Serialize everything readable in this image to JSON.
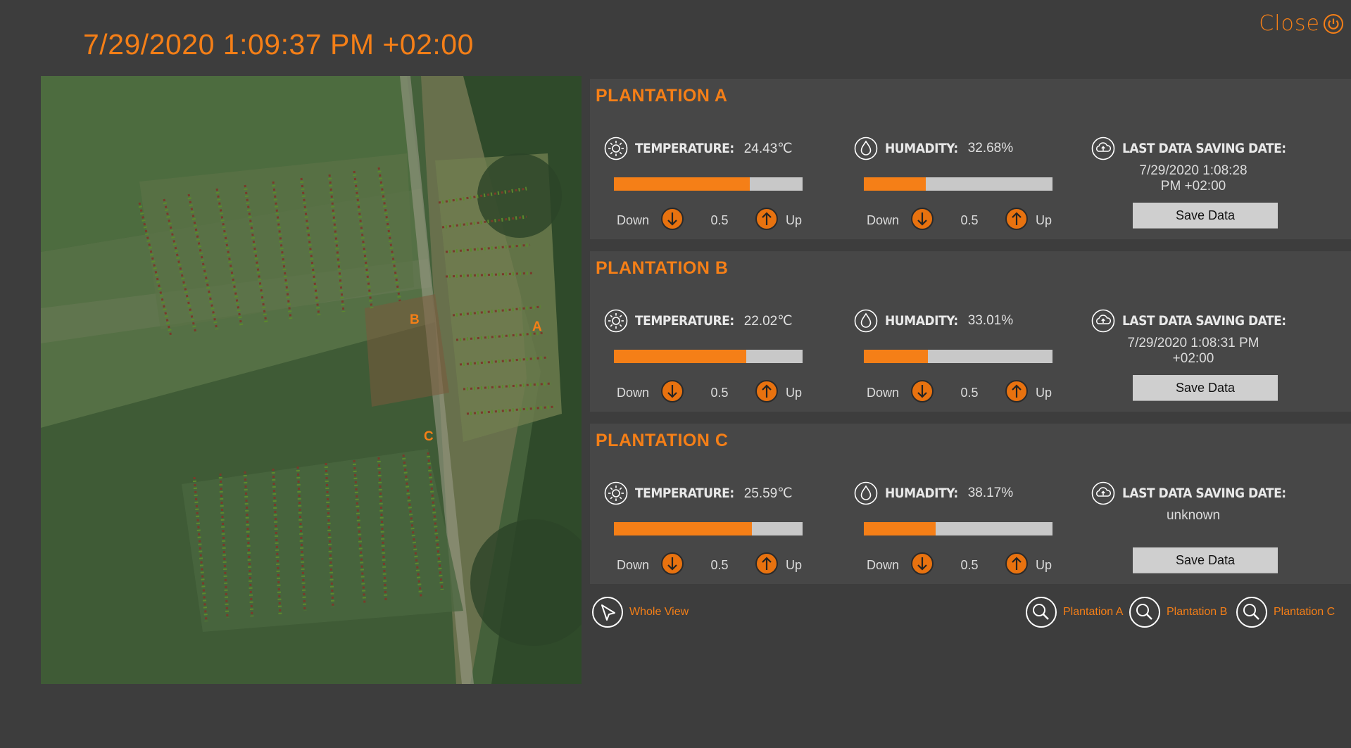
{
  "header": {
    "datetime": "7/29/2020 1:09:37 PM +02:00",
    "close_label": "Close"
  },
  "map": {
    "labels": {
      "a": "A",
      "b": "B",
      "c": "C"
    }
  },
  "panels": [
    {
      "title": "PLANTATION A",
      "temperature": {
        "label": "TEMPERATURE:",
        "value": "24.43℃",
        "level": 0.72
      },
      "humidity": {
        "label": "HUMADITY:",
        "value": "32.68%",
        "level": 0.33
      },
      "controls": {
        "down": "Down",
        "step": "0.5",
        "up": "Up"
      },
      "save": {
        "label": "LAST DATA SAVING DATE:",
        "date_line1": "7/29/2020 1:08:28",
        "date_line2": "PM +02:00",
        "button": "Save Data"
      }
    },
    {
      "title": "PLANTATION B",
      "temperature": {
        "label": "TEMPERATURE:",
        "value": "22.02℃",
        "level": 0.7
      },
      "humidity": {
        "label": "HUMADITY:",
        "value": "33.01%",
        "level": 0.34
      },
      "controls": {
        "down": "Down",
        "step": "0.5",
        "up": "Up"
      },
      "save": {
        "label": "LAST DATA SAVING DATE:",
        "date_line1": "7/29/2020 1:08:31 PM",
        "date_line2": "+02:00",
        "button": "Save Data"
      }
    },
    {
      "title": "PLANTATION C",
      "temperature": {
        "label": "TEMPERATURE:",
        "value": "25.59℃",
        "level": 0.73
      },
      "humidity": {
        "label": "HUMADITY:",
        "value": "38.17%",
        "level": 0.38
      },
      "controls": {
        "down": "Down",
        "step": "0.5",
        "up": "Up"
      },
      "save": {
        "label": "LAST DATA SAVING DATE:",
        "date_line1": "unknown",
        "date_line2": "",
        "button": "Save Data"
      }
    }
  ],
  "nav": {
    "whole_view": "Whole View",
    "plantation_a": "Plantation A",
    "plantation_b": "Plantation B",
    "plantation_c": "Plantation C"
  },
  "colors": {
    "accent": "#f57f17",
    "background": "#3d3d3d",
    "panel": "#474747",
    "bar_track": "#c8c8c8"
  },
  "icons": {
    "sun": "sun-icon",
    "drop": "water-drop-icon",
    "cloud": "cloud-upload-icon",
    "down": "arrow-down-circle-icon",
    "up": "arrow-up-circle-icon",
    "pointer": "cursor-arrow-icon",
    "zoom": "magnifier-icon",
    "close": "power-icon"
  }
}
